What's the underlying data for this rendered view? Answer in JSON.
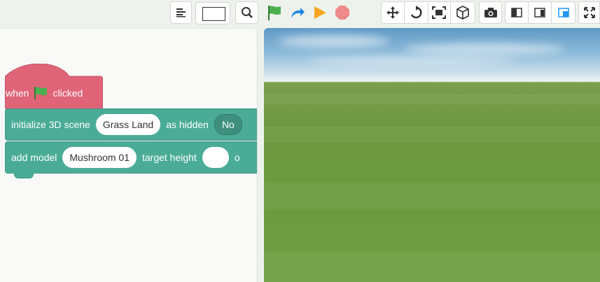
{
  "toolbar": {
    "buttons": [
      {
        "name": "code-view-toggle-button",
        "icon": "align-left-icon"
      },
      {
        "name": "zoom-to-fit-button",
        "icon": "search-icon"
      },
      {
        "name": "run-button",
        "icon": "green-flag-icon"
      },
      {
        "name": "step-button",
        "icon": "redo-arrow-icon"
      },
      {
        "name": "play-button",
        "icon": "play-icon"
      },
      {
        "name": "stop-button",
        "icon": "stop-icon"
      },
      {
        "name": "move-camera-button",
        "icon": "move-arrows-icon"
      },
      {
        "name": "rotate-camera-button",
        "icon": "rotate-icon"
      },
      {
        "name": "frame-button",
        "icon": "frame-icon"
      },
      {
        "name": "3d-box-button",
        "icon": "cube-icon"
      },
      {
        "name": "screenshot-button",
        "icon": "camera-icon"
      },
      {
        "name": "layout-left-button",
        "icon": "layout-left-icon"
      },
      {
        "name": "layout-right-button",
        "icon": "layout-right-icon"
      },
      {
        "name": "layout-overlay-button",
        "icon": "layout-overlay-icon"
      },
      {
        "name": "fullscreen-button",
        "icon": "expand-icon"
      }
    ],
    "colors": {
      "flag": "#4caf50",
      "step": "#1e88e5",
      "play": "#f5a623",
      "stop": "#e57373",
      "active_layout": "#2196f3"
    }
  },
  "blocks": {
    "when_clicked": {
      "prefix": "when",
      "suffix": "clicked",
      "color": "#e06477"
    },
    "init_scene": {
      "label": "initialize 3D scene",
      "scene_value": "Grass Land",
      "hidden_label": "as hidden",
      "hidden_value": "No",
      "color": "#4aac97"
    },
    "add_model": {
      "label": "add model",
      "model_value": "Mushroom 01",
      "height_label": "target height",
      "height_value": "",
      "trailing": "o"
    }
  }
}
